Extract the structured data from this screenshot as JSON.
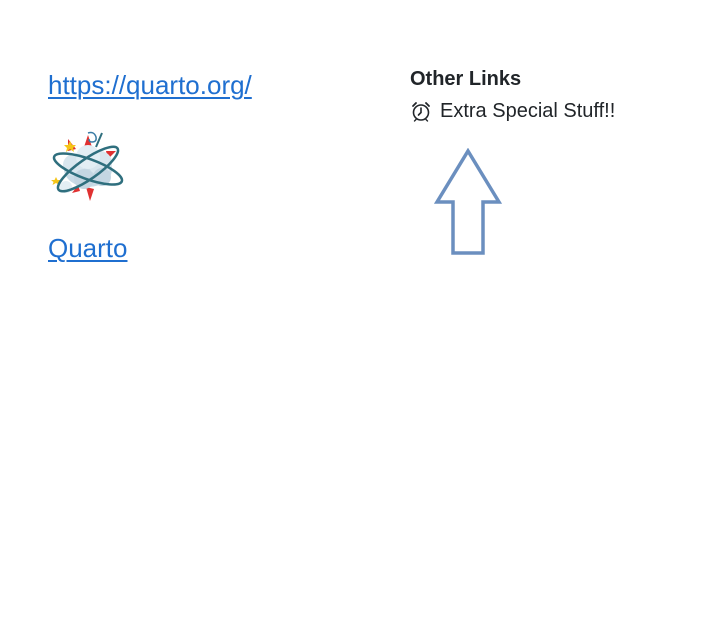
{
  "main": {
    "url_link": "https://quarto.org/",
    "image_alt": "",
    "quarto_link": "Quarto"
  },
  "sidebar": {
    "heading": "Other Links",
    "links": [
      {
        "label": "Extra Special Stuff!!",
        "icon": "alarm-clock-icon"
      }
    ]
  },
  "colors": {
    "link": "#1f6fd0",
    "text": "#212529",
    "arrow_stroke": "#6b8fbf"
  }
}
